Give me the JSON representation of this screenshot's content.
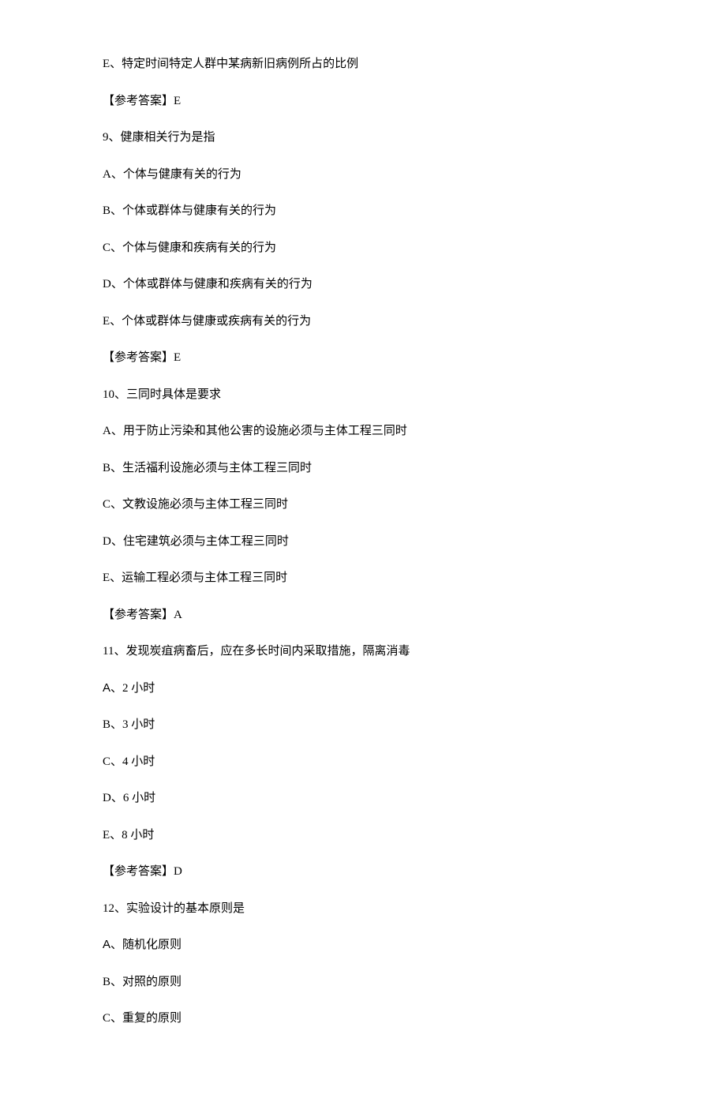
{
  "lines": [
    {
      "prefix": "E、",
      "text": "特定时间特定人群中某病新旧病例所占的比例"
    },
    {
      "prefix": "",
      "text": "【参考答案】E"
    },
    {
      "prefix": "9、",
      "text": "健康相关行为是指"
    },
    {
      "prefix": "A、",
      "text": "个体与健康有关的行为"
    },
    {
      "prefix": "B、",
      "text": "个体或群体与健康有关的行为"
    },
    {
      "prefix": "C、",
      "text": "个体与健康和疾病有关的行为"
    },
    {
      "prefix": "D、",
      "text": "个体或群体与健康和疾病有关的行为"
    },
    {
      "prefix": "E、",
      "text": "个体或群体与健康或疾病有关的行为"
    },
    {
      "prefix": "",
      "text": "【参考答案】E"
    },
    {
      "prefix": "10、",
      "text": "三同时具体是要求"
    },
    {
      "prefix": "A、",
      "text": "用于防止污染和其他公害的设施必须与主体工程三同时"
    },
    {
      "prefix": "B、",
      "text": "生活福利设施必须与主体工程三同时"
    },
    {
      "prefix": "C、",
      "text": "文教设施必须与主体工程三同时"
    },
    {
      "prefix": "D、",
      "text": "住宅建筑必须与主体工程三同时"
    },
    {
      "prefix": "E、",
      "text": "运输工程必须与主体工程三同时"
    },
    {
      "prefix": "",
      "text": "【参考答案】A"
    },
    {
      "prefix": "11、",
      "text": "发现炭疽病畜后，应在多长时间内采取措施，隔离消毒"
    },
    {
      "prefix": "A、",
      "prefixClass": "sans",
      "text": "2 小时"
    },
    {
      "prefix": "B、",
      "text": "3 小时"
    },
    {
      "prefix": "C、",
      "text": "4 小时"
    },
    {
      "prefix": "D、",
      "text": "6 小时"
    },
    {
      "prefix": "E、",
      "text": "8 小时"
    },
    {
      "prefix": "",
      "text": "【参考答案】D"
    },
    {
      "prefix": "12、",
      "text": "实验设计的基本原则是"
    },
    {
      "prefix": "A、",
      "prefixClass": "sans",
      "text": "随机化原则"
    },
    {
      "prefix": "B、",
      "text": "对照的原则"
    },
    {
      "prefix": "C、",
      "text": "重复的原则"
    }
  ]
}
